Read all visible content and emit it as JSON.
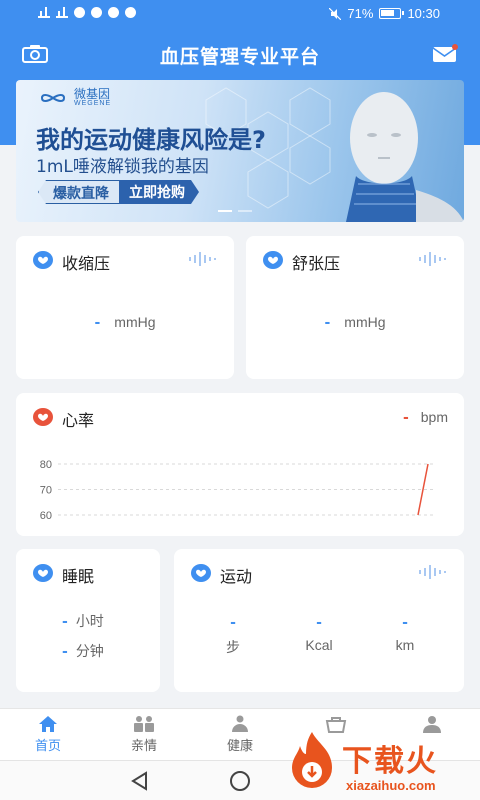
{
  "status_bar": {
    "battery_percent": "71%",
    "time": "10:30"
  },
  "header": {
    "title": "血压管理专业平台",
    "camera_icon": "camera-icon",
    "mail_icon": "mail-icon"
  },
  "banner": {
    "brand_name": "微基因",
    "brand_sub": "WEGENE",
    "headline": "我的运动健康风险是?",
    "subline": "1mL唾液解锁我的基因",
    "cta_left": "爆款直降",
    "cta_right": "立即抢购"
  },
  "systolic": {
    "title": "收缩压",
    "value": "-",
    "unit": "mmHg"
  },
  "diastolic": {
    "title": "舒张压",
    "value": "-",
    "unit": "mmHg"
  },
  "heart_rate": {
    "title": "心率",
    "value": "-",
    "unit": "bpm",
    "accent": "#e8533b"
  },
  "chart_data": {
    "type": "line",
    "title": "",
    "xlabel": "",
    "ylabel": "",
    "ylim": [
      60,
      80
    ],
    "y_ticks": [
      "80",
      "70",
      "60"
    ],
    "series": [
      {
        "values": [
          60,
          80
        ]
      }
    ]
  },
  "sleep": {
    "title": "睡眠",
    "hours_value": "-",
    "hours_unit": "小时",
    "minutes_value": "-",
    "minutes_unit": "分钟"
  },
  "sport": {
    "title": "运动",
    "items": [
      {
        "value": "-",
        "unit": "步"
      },
      {
        "value": "-",
        "unit": "Kcal"
      },
      {
        "value": "-",
        "unit": "km"
      }
    ]
  },
  "tabs": [
    {
      "label": "首页",
      "icon": "home-icon"
    },
    {
      "label": "亲情",
      "icon": "family-icon"
    },
    {
      "label": "健康",
      "icon": "health-icon"
    },
    {
      "label": "",
      "icon": "shop-icon"
    },
    {
      "label": "",
      "icon": "profile-icon"
    }
  ],
  "watermark": {
    "text": "下载火",
    "url": "xiazaihuo.com"
  },
  "colors": {
    "primary": "#3f8ff0",
    "heart": "#e8533b",
    "watermark": "#e8541e"
  }
}
